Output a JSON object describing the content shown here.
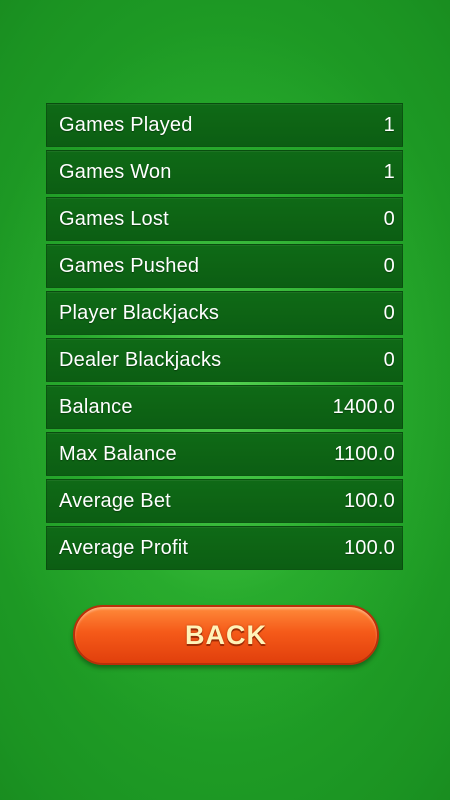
{
  "stats": [
    {
      "label": "Games Played",
      "value": "1"
    },
    {
      "label": "Games Won",
      "value": "1"
    },
    {
      "label": "Games Lost",
      "value": "0"
    },
    {
      "label": "Games Pushed",
      "value": "0"
    },
    {
      "label": "Player Blackjacks",
      "value": "0"
    },
    {
      "label": "Dealer Blackjacks",
      "value": "0"
    },
    {
      "label": "Balance",
      "value": "1400.0"
    },
    {
      "label": "Max Balance",
      "value": "1100.0"
    },
    {
      "label": "Average Bet",
      "value": "100.0"
    },
    {
      "label": "Average Profit",
      "value": "100.0"
    }
  ],
  "back_button": {
    "label": "BACK"
  },
  "colors": {
    "felt": "#1b9322",
    "row_bg": "#0f6a16",
    "button": "#f55a19",
    "button_text": "#fff3b8"
  }
}
